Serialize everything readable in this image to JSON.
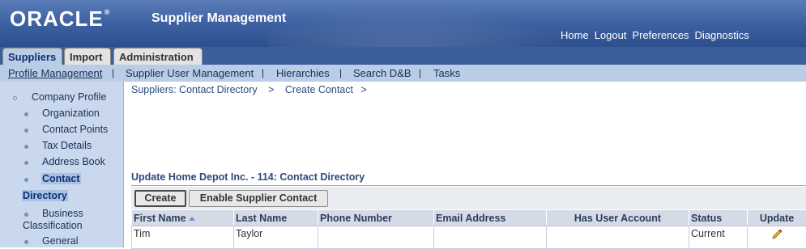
{
  "brand": {
    "logo": "ORACLE",
    "registered": "®",
    "app_title": "Supplier Management"
  },
  "global_links": [
    "Home",
    "Logout",
    "Preferences",
    "Diagnostics"
  ],
  "tabs": [
    {
      "label": "Suppliers",
      "active": true
    },
    {
      "label": "Import",
      "active": false
    },
    {
      "label": "Administration",
      "active": false
    }
  ],
  "subtabs": [
    {
      "label": "Profile Management",
      "active": true
    },
    {
      "label": "Supplier User Management"
    },
    {
      "label": "Hierarchies"
    },
    {
      "label": "Search D&B"
    },
    {
      "label": "Tasks"
    }
  ],
  "subtab_separator": "|",
  "sidenav": {
    "header": "Company Profile",
    "items": [
      "Organization",
      "Contact Points",
      "Tax Details",
      "Address Book",
      "Contact",
      "Directory",
      "Business",
      "Classification",
      "General"
    ]
  },
  "breadcrumb": {
    "item1": "Suppliers: Contact Directory",
    "sep": ">",
    "item2": "Create Contact",
    "sep2": ">"
  },
  "section_title": "Update Home Depot Inc. - 114: Contact Directory",
  "buttons": {
    "create": "Create",
    "enable_contact": "Enable Supplier Contact"
  },
  "table": {
    "columns": [
      "First Name",
      "Last Name",
      "Phone Number",
      "Email Address",
      "Has User Account",
      "Status",
      "Update"
    ],
    "rows": [
      {
        "first_name": "Tim",
        "last_name": "Taylor",
        "phone": "",
        "email": "",
        "has_account": "",
        "status": "Current"
      }
    ]
  },
  "colors": {
    "header": "#3f63a3",
    "subtab_bar": "#b9cde6",
    "sidenav": "#c9d8ec",
    "accent_text": "#2b4a7a"
  },
  "icons": [
    "sort-ascending-icon",
    "pencil-edit-icon"
  ]
}
